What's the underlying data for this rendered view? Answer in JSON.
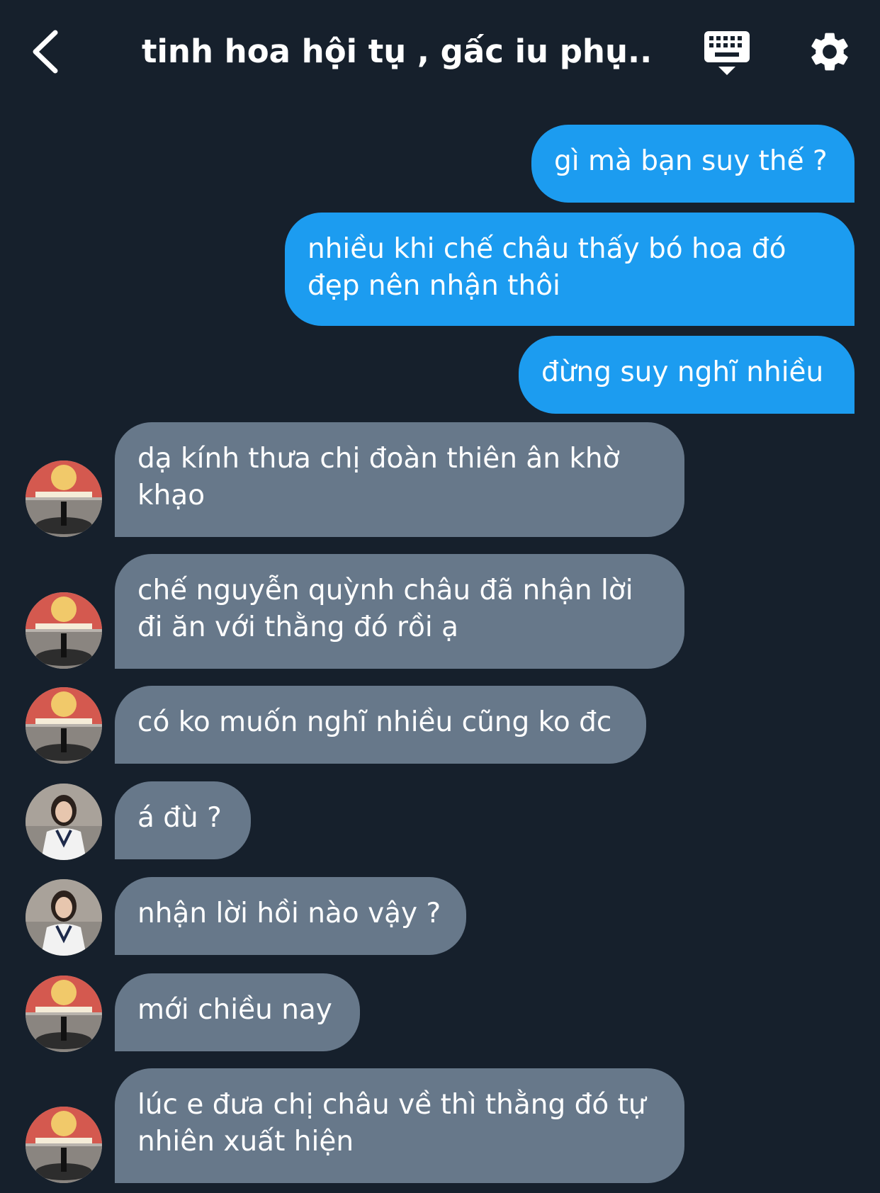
{
  "header": {
    "title": "tinh hoa hội tụ , gấc iu phụ...",
    "back_icon": "chevron-left-icon",
    "keyboard_icon": "keyboard-icon",
    "settings_icon": "gear-icon"
  },
  "colors": {
    "background": "#16202c",
    "outgoing_bubble": "#1c9cf0",
    "incoming_bubble": "#67788a",
    "text": "#ffffff"
  },
  "messages": [
    {
      "direction": "outgoing",
      "text": "gì mà bạn suy thế ?"
    },
    {
      "direction": "outgoing",
      "text": "nhiều khi chế châu thấy bó hoa đó đẹp nên nhận thôi"
    },
    {
      "direction": "outgoing",
      "text": "đừng suy nghĩ nhiều"
    },
    {
      "direction": "incoming",
      "avatar": "avatar-poster",
      "text": "dạ kính thưa chị đoàn thiên ân khờ khạo"
    },
    {
      "direction": "incoming",
      "avatar": "avatar-poster",
      "text": "chế nguyễn quỳnh châu đã nhận lời đi ăn với thằng đó rồi ạ"
    },
    {
      "direction": "incoming",
      "avatar": "avatar-poster",
      "text": "có ko muốn nghĩ nhiều cũng ko đc"
    },
    {
      "direction": "incoming",
      "avatar": "avatar-girl",
      "text": "á đù ?"
    },
    {
      "direction": "incoming",
      "avatar": "avatar-girl",
      "text": "nhận lời hồi nào vậy ?"
    },
    {
      "direction": "incoming",
      "avatar": "avatar-poster",
      "text": "mới chiều nay"
    },
    {
      "direction": "incoming",
      "avatar": "avatar-poster",
      "text": "lúc e đưa chị châu về thì thằng đó tự nhiên xuất hiện"
    }
  ]
}
